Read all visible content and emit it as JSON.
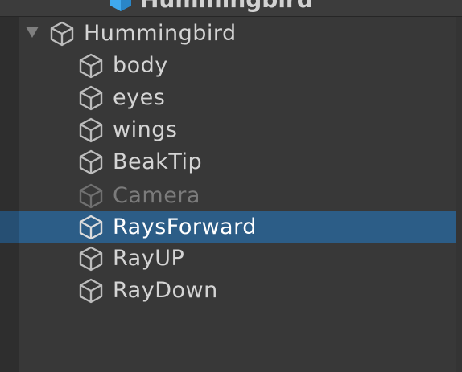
{
  "header": {
    "title": "Hummingbird",
    "icon": "prefab-cube-icon"
  },
  "colors": {
    "background": "#383838",
    "selected_row": "#2c5d87",
    "prefab_icon": "#3fa9ee",
    "text": "#d4d4d4",
    "text_disabled": "#7b7b7b"
  },
  "hierarchy": {
    "root": {
      "label": "Hummingbird",
      "icon": "cube-icon",
      "expanded": true
    },
    "children": [
      {
        "label": "body",
        "icon": "cube-icon",
        "active": true,
        "selected": false
      },
      {
        "label": "eyes",
        "icon": "cube-icon",
        "active": true,
        "selected": false
      },
      {
        "label": "wings",
        "icon": "cube-icon",
        "active": true,
        "selected": false
      },
      {
        "label": "BeakTip",
        "icon": "cube-icon",
        "active": true,
        "selected": false
      },
      {
        "label": "Camera",
        "icon": "cube-icon",
        "active": false,
        "selected": false
      },
      {
        "label": "RaysForward",
        "icon": "cube-icon",
        "active": true,
        "selected": true
      },
      {
        "label": "RayUP",
        "icon": "cube-icon",
        "active": true,
        "selected": false
      },
      {
        "label": "RayDown",
        "icon": "cube-icon",
        "active": true,
        "selected": false
      }
    ]
  }
}
